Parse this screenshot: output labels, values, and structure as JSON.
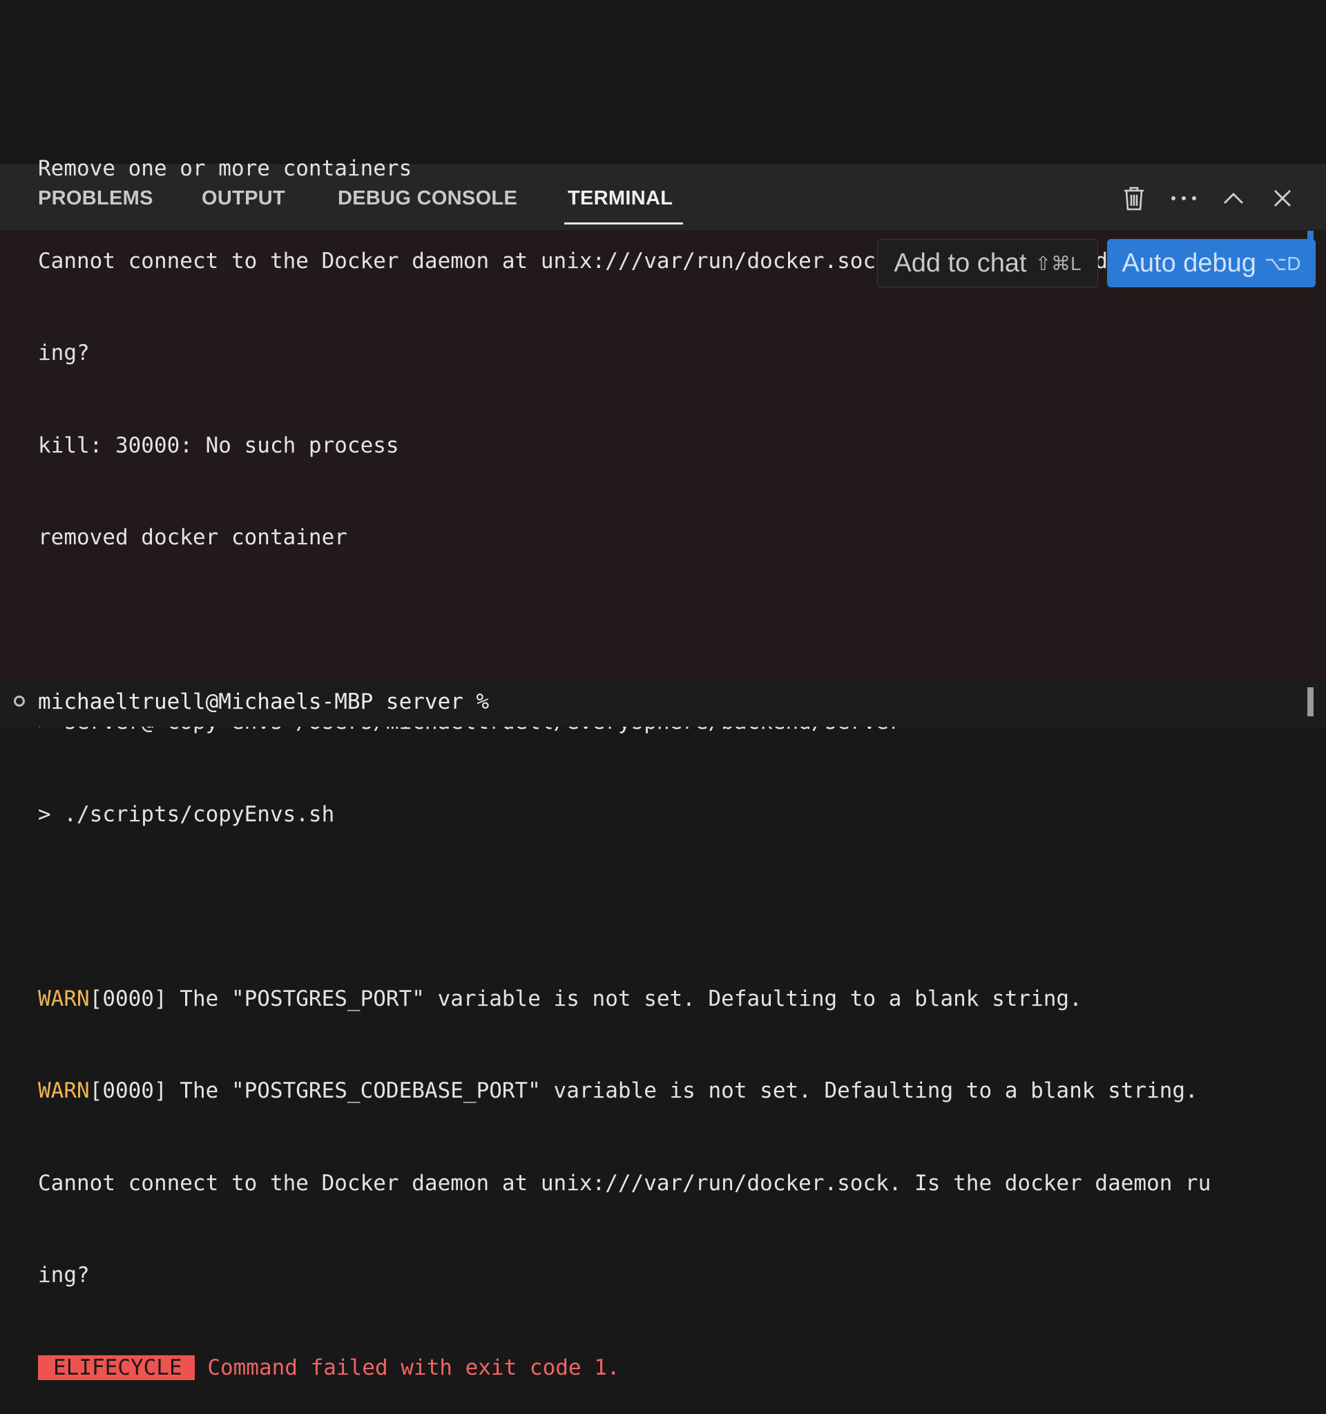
{
  "panel": {
    "tabs": [
      {
        "label": "PROBLEMS"
      },
      {
        "label": "OUTPUT"
      },
      {
        "label": "DEBUG CONSOLE"
      },
      {
        "label": "TERMINAL",
        "active": true
      }
    ],
    "icons": [
      "trash-icon",
      "more-icon",
      "chevron-up-icon",
      "close-icon"
    ]
  },
  "actions": {
    "add_to_chat": "Add to chat",
    "add_to_chat_shortcut": "⇧⌘L",
    "auto_debug": "Auto debug",
    "auto_debug_shortcut": "⌥D"
  },
  "terminal": {
    "lines": [
      "Remove one or more containers",
      "Cannot connect to the Docker daemon at unix:///var/run/docker.sock. Is the docker daemon runn",
      "ing?",
      "kill: 30000: No such process",
      "removed docker container",
      "",
      "> server@ copy-envs /Users/michaeltruell/everysphere/backend/server",
      "> ./scripts/copyEnvs.sh",
      ""
    ],
    "warn_label": "WARN",
    "warn_lines": [
      "[0000] The \"POSTGRES_PORT\" variable is not set. Defaulting to a blank string.",
      "[0000] The \"POSTGRES_CODEBASE_PORT\" variable is not set. Defaulting to a blank string."
    ],
    "after_warn": [
      "Cannot connect to the Docker daemon at unix:///var/run/docker.sock. Is the docker daemon ru",
      "ing?"
    ],
    "error_badge": "ELIFECYCLE",
    "error_message": "Command failed with exit code 1.",
    "prompt": "michaeltruell@Michaels-MBP server %"
  },
  "colors": {
    "warn": "#f0b451",
    "error": "#f26464",
    "accent": "#2b7ad6"
  }
}
